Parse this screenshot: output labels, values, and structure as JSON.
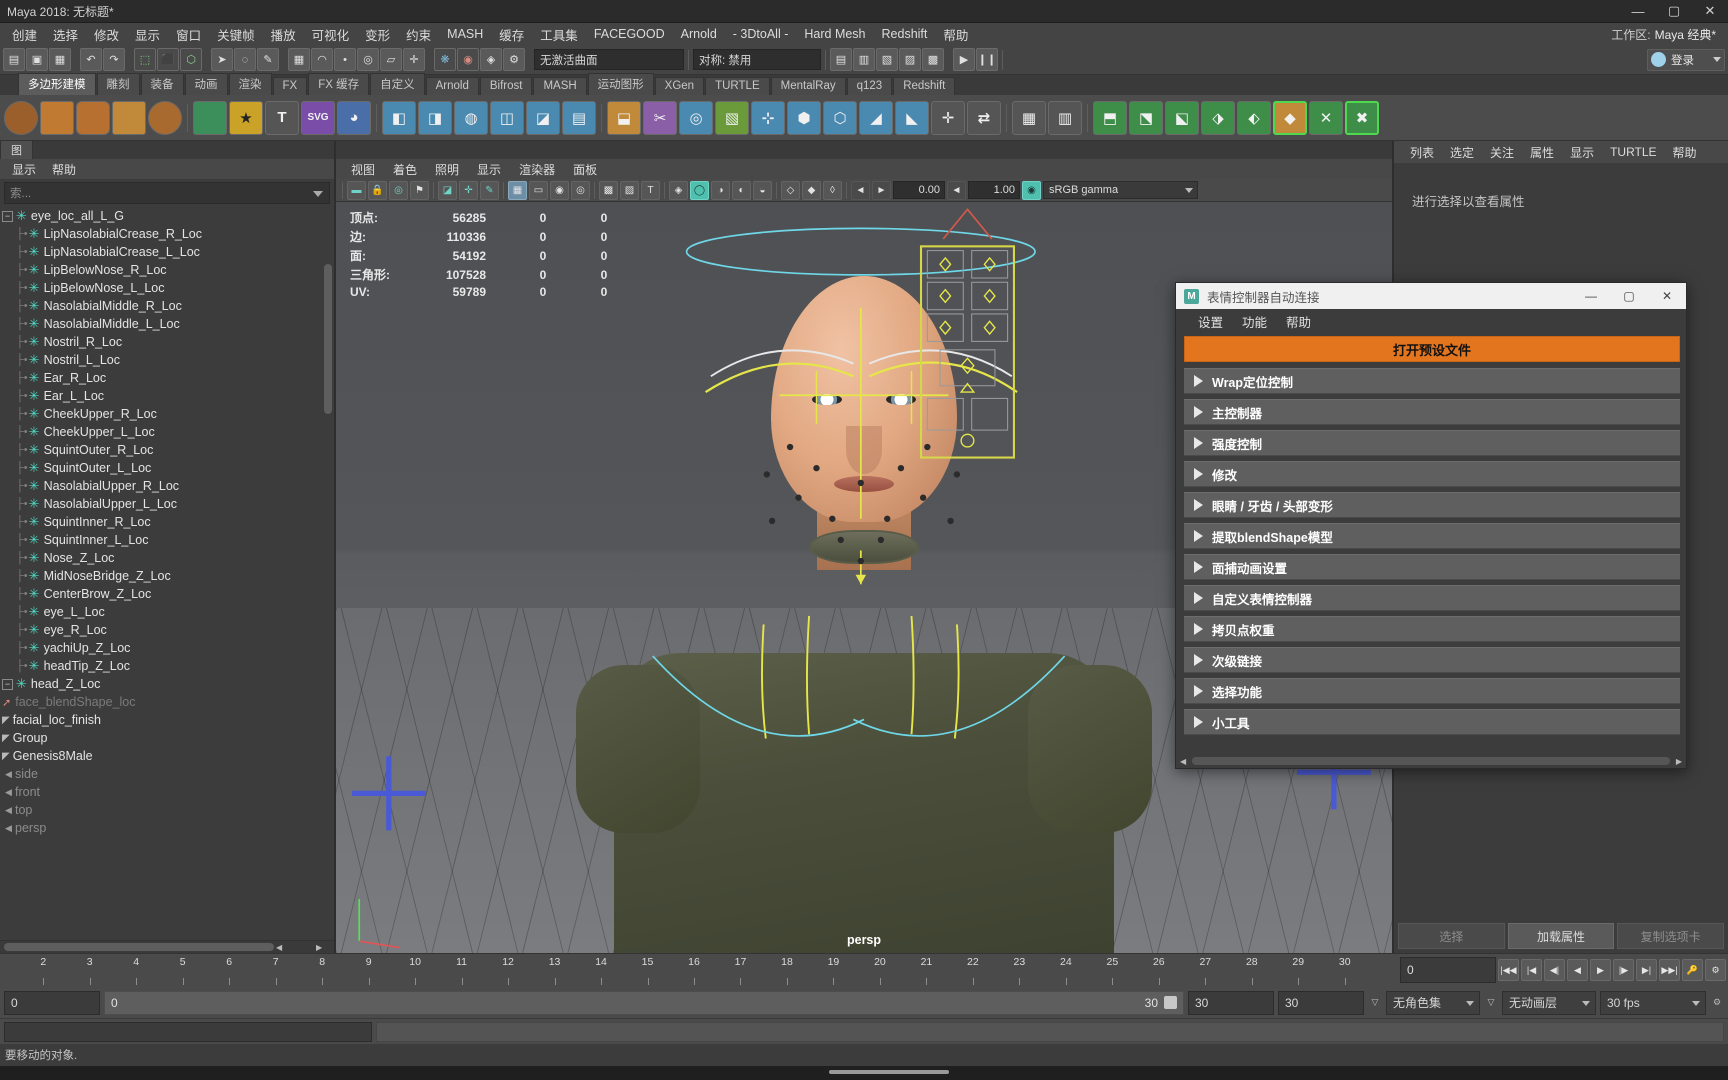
{
  "window": {
    "title": "Maya 2018: 无标题*",
    "minimize": "—",
    "maximize": "▢",
    "close": "✕"
  },
  "menubar": {
    "items": [
      "创建",
      "选择",
      "修改",
      "显示",
      "窗口",
      "关键帧",
      "播放",
      "可视化",
      "变形",
      "约束",
      "MASH",
      "缓存",
      "工具集",
      "FACEGOOD",
      "Arnold",
      "- 3DtoAll -",
      "Hard Mesh",
      "Redshift",
      "帮助"
    ],
    "workspace_label": "工作区:",
    "workspace_value": "Maya 经典*"
  },
  "status_line": {
    "snap_field_value": "无激活曲面",
    "pair_label": "对称: 禁用",
    "login_label": "登录"
  },
  "shelf": {
    "tabs": [
      "多边形建模",
      "雕刻",
      "装备",
      "动画",
      "渲染",
      "FX",
      "FX 缓存",
      "自定义",
      "Arnold",
      "Bifrost",
      "MASH",
      "运动图形",
      "XGen",
      "TURTLE",
      "MentalRay",
      "q123",
      "Redshift"
    ],
    "active_tab": "多边形建模"
  },
  "outliner": {
    "tab": "图",
    "menu": [
      "显示",
      "帮助"
    ],
    "search_placeholder": "索...",
    "rows": [
      {
        "label": "persp",
        "type": "camera",
        "indent": 0,
        "dim": true
      },
      {
        "label": "top",
        "type": "camera",
        "indent": 0,
        "dim": true
      },
      {
        "label": "front",
        "type": "camera",
        "indent": 0,
        "dim": true
      },
      {
        "label": "side",
        "type": "camera",
        "indent": 0,
        "dim": true
      },
      {
        "label": "Genesis8Male",
        "type": "group",
        "indent": 0,
        "dim": false
      },
      {
        "label": "Group",
        "type": "group",
        "indent": 0,
        "dim": false
      },
      {
        "label": "facial_loc_finish",
        "type": "group",
        "indent": 0,
        "dim": false
      },
      {
        "label": "face_blendShape_loc",
        "type": "hidden",
        "indent": 0,
        "dim": true
      },
      {
        "label": "head_Z_Loc",
        "type": "loc-parent",
        "indent": 0,
        "dim": false
      },
      {
        "label": "headTip_Z_Loc",
        "type": "loc",
        "indent": 1,
        "dim": false
      },
      {
        "label": "yachiUp_Z_Loc",
        "type": "loc",
        "indent": 1,
        "dim": false
      },
      {
        "label": "eye_R_Loc",
        "type": "loc",
        "indent": 1,
        "dim": false
      },
      {
        "label": "eye_L_Loc",
        "type": "loc",
        "indent": 1,
        "dim": false
      },
      {
        "label": "CenterBrow_Z_Loc",
        "type": "loc",
        "indent": 1,
        "dim": false
      },
      {
        "label": "MidNoseBridge_Z_Loc",
        "type": "loc",
        "indent": 1,
        "dim": false
      },
      {
        "label": "Nose_Z_Loc",
        "type": "loc",
        "indent": 1,
        "dim": false
      },
      {
        "label": "SquintInner_L_Loc",
        "type": "loc",
        "indent": 1,
        "dim": false
      },
      {
        "label": "SquintInner_R_Loc",
        "type": "loc",
        "indent": 1,
        "dim": false
      },
      {
        "label": "NasolabialUpper_L_Loc",
        "type": "loc",
        "indent": 1,
        "dim": false
      },
      {
        "label": "NasolabialUpper_R_Loc",
        "type": "loc",
        "indent": 1,
        "dim": false
      },
      {
        "label": "SquintOuter_L_Loc",
        "type": "loc",
        "indent": 1,
        "dim": false
      },
      {
        "label": "SquintOuter_R_Loc",
        "type": "loc",
        "indent": 1,
        "dim": false
      },
      {
        "label": "CheekUpper_L_Loc",
        "type": "loc",
        "indent": 1,
        "dim": false
      },
      {
        "label": "CheekUpper_R_Loc",
        "type": "loc",
        "indent": 1,
        "dim": false
      },
      {
        "label": "Ear_L_Loc",
        "type": "loc",
        "indent": 1,
        "dim": false
      },
      {
        "label": "Ear_R_Loc",
        "type": "loc",
        "indent": 1,
        "dim": false
      },
      {
        "label": "Nostril_L_Loc",
        "type": "loc",
        "indent": 1,
        "dim": false
      },
      {
        "label": "Nostril_R_Loc",
        "type": "loc",
        "indent": 1,
        "dim": false
      },
      {
        "label": "NasolabialMiddle_L_Loc",
        "type": "loc",
        "indent": 1,
        "dim": false
      },
      {
        "label": "NasolabialMiddle_R_Loc",
        "type": "loc",
        "indent": 1,
        "dim": false
      },
      {
        "label": "LipBelowNose_L_Loc",
        "type": "loc",
        "indent": 1,
        "dim": false
      },
      {
        "label": "LipBelowNose_R_Loc",
        "type": "loc",
        "indent": 1,
        "dim": false
      },
      {
        "label": "LipNasolabialCrease_L_Loc",
        "type": "loc",
        "indent": 1,
        "dim": false
      },
      {
        "label": "LipNasolabialCrease_R_Loc",
        "type": "loc",
        "indent": 1,
        "dim": false
      },
      {
        "label": "eye_loc_all_L_G",
        "type": "loc-parent",
        "indent": 0,
        "dim": false
      }
    ]
  },
  "viewport": {
    "menu": [
      "视图",
      "着色",
      "照明",
      "显示",
      "渲染器",
      "面板"
    ],
    "exposure": "0.00",
    "gamma": "1.00",
    "color_space": "sRGB gamma",
    "camera_label": "persp",
    "hud": {
      "rows": [
        {
          "key": "顶点:",
          "v1": "56285",
          "v2": "0",
          "v3": "0"
        },
        {
          "key": "边:",
          "v1": "110336",
          "v2": "0",
          "v3": "0"
        },
        {
          "key": "面:",
          "v1": "54192",
          "v2": "0",
          "v3": "0"
        },
        {
          "key": "三角形:",
          "v1": "107528",
          "v2": "0",
          "v3": "0"
        },
        {
          "key": "UV:",
          "v1": "59789",
          "v2": "0",
          "v3": "0"
        }
      ]
    }
  },
  "right_panel": {
    "menu": [
      "列表",
      "选定",
      "关注",
      "属性",
      "显示",
      "TURTLE",
      "帮助"
    ],
    "empty_text": "进行选择以查看属性",
    "buttons": [
      "选择",
      "加载属性",
      "复制选项卡"
    ]
  },
  "timeline": {
    "ticks": [
      "2",
      "3",
      "4",
      "5",
      "6",
      "7",
      "8",
      "9",
      "10",
      "11",
      "12",
      "13",
      "14",
      "15",
      "16",
      "17",
      "18",
      "19",
      "20",
      "21",
      "22",
      "23",
      "24",
      "25",
      "26",
      "27",
      "28",
      "29",
      "30"
    ],
    "current_frame": "0"
  },
  "range": {
    "start_field": "0",
    "anim_start": "0",
    "anim_end": "30",
    "playback_end": "30",
    "range_end": "30",
    "character_set": "无角色集",
    "anim_layer": "无动画层",
    "fps": "30 fps"
  },
  "help_line": {
    "text": "要移动的对象."
  },
  "dialog": {
    "title": "表情控制器自动连接",
    "icon_letter": "M",
    "minimize": "—",
    "maximize": "▢",
    "close": "✕",
    "menu": [
      "设置",
      "功能",
      "帮助"
    ],
    "open_preset_button": "打开预设文件",
    "sections": [
      "Wrap定位控制",
      "主控制器",
      "强度控制",
      "修改",
      "眼睛 / 牙齿 / 头部变形",
      "提取blendShape模型",
      "面捕动画设置",
      "自定义表情控制器",
      "拷贝点权重",
      "次级链接",
      "选择功能",
      "小工具"
    ]
  },
  "colors": {
    "accent_orange": "#e2751e",
    "locator_teal": "#4fd9c4",
    "panel_bg": "#3c3c3c",
    "curve_yellow": "#e6e64a",
    "curve_cyan": "#6fd8e8",
    "controller_blue": "#4a5ad6"
  }
}
